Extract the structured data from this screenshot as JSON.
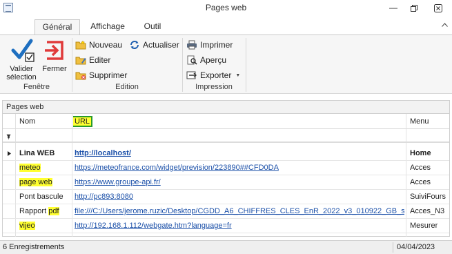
{
  "window": {
    "title": "Pages web"
  },
  "tabs": [
    {
      "label": "Général"
    },
    {
      "label": "Affichage"
    },
    {
      "label": "Outil"
    }
  ],
  "ribbon": {
    "fenetre": {
      "label": "Fenêtre",
      "validate": {
        "line1": "Valider",
        "line2": "sélection"
      },
      "close": "Fermer"
    },
    "edition": {
      "label": "Edition",
      "new": "Nouveau",
      "edit": "Editer",
      "delete": "Supprimer",
      "refresh": "Actualiser"
    },
    "impression": {
      "label": "Impression",
      "print": "Imprimer",
      "preview": "Aperçu",
      "export": "Exporter"
    }
  },
  "panel": {
    "title": "Pages web"
  },
  "grid": {
    "columns": {
      "name": "Nom",
      "url": "URL",
      "menu": "Menu"
    },
    "rows": [
      {
        "name": "Lina WEB",
        "url": "http://localhost/",
        "menu": "Home"
      },
      {
        "name": "meteo",
        "url": "https://meteofrance.com/widget/prevision/223890##CFD0DA",
        "menu": "Acces"
      },
      {
        "name": "page web",
        "url": "https://www.groupe-api.fr/",
        "menu": "Acces"
      },
      {
        "name": "Pont bascule",
        "url": "http://pc893:8080",
        "menu": "SuiviFours"
      },
      {
        "name_prefix": "Rapport ",
        "name_hl": "pdf",
        "url": "file:///C:/Users/jerome.ruzic/Desktop/CGDD_A6_CHIFFRES_CLES_EnR_2022_v3_010922_GB_s...",
        "menu": "Acces_N3"
      },
      {
        "name": "vijeo",
        "url": "http://192.168.1.112/webgate.htm?language=fr",
        "menu": "Mesurer"
      }
    ]
  },
  "status": {
    "count": "6 Enregistrements",
    "date": "04/04/2023"
  },
  "colors": {
    "highlight": "#ffff30",
    "link": "#1a4fa8",
    "accent_green": "#2a9a2a",
    "close_red": "#e03a3a"
  }
}
